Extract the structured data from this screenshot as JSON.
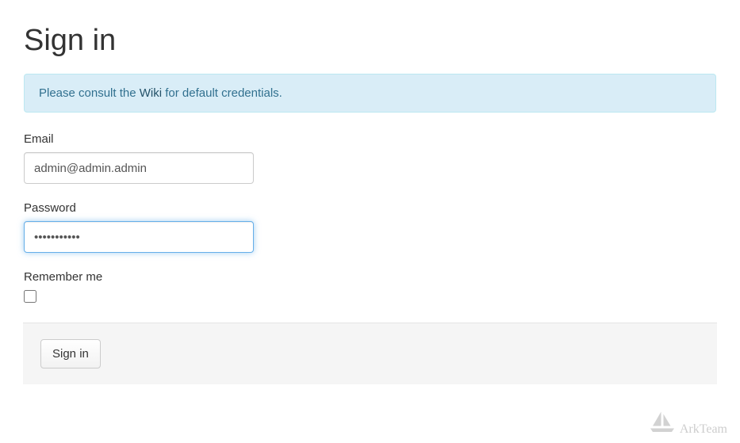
{
  "page": {
    "title": "Sign in"
  },
  "alert": {
    "prefix": "Please consult the ",
    "link_text": "Wiki",
    "suffix": " for default credentials."
  },
  "form": {
    "email": {
      "label": "Email",
      "value": "admin@admin.admin"
    },
    "password": {
      "label": "Password",
      "value": "•••••••••••"
    },
    "remember": {
      "label": "Remember me",
      "checked": false
    },
    "submit": {
      "label": "Sign in"
    }
  },
  "watermark": {
    "text": "ArkTeam"
  }
}
